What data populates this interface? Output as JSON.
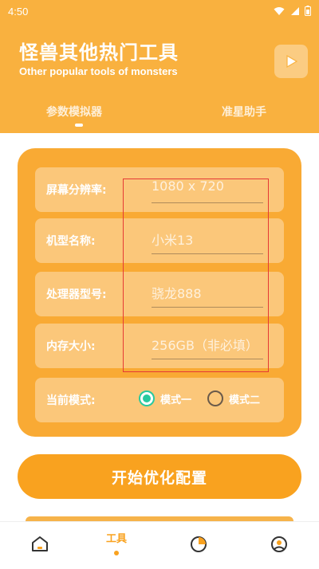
{
  "status_bar": {
    "time": "4:50",
    "icons": [
      "wifi-icon",
      "signal-icon",
      "battery-icon"
    ]
  },
  "header": {
    "title": "怪兽其他热门工具",
    "subtitle": "Other popular tools of monsters",
    "tabs": [
      {
        "label": "参数模拟器",
        "active": true
      },
      {
        "label": "准星助手",
        "active": false
      }
    ],
    "colors": {
      "primary": "#f9b13f",
      "accent": "#f9a21f",
      "radio": "#27c9a0"
    }
  },
  "form": {
    "resolution": {
      "label": "屏幕分辨率:",
      "placeholder": "1080 x 720"
    },
    "model": {
      "label": "机型名称:",
      "placeholder": "小米13"
    },
    "processor": {
      "label": "处理器型号:",
      "placeholder": "骁龙888"
    },
    "memory": {
      "label": "内存大小:",
      "placeholder": "256GB（非必填）"
    },
    "mode": {
      "label": "当前模式:",
      "options": [
        "模式一",
        "模式二"
      ],
      "selected": "模式一"
    }
  },
  "start_button": {
    "label": "开始优化配置"
  },
  "bottom_nav": {
    "items": [
      {
        "label": "",
        "icon": "home-icon"
      },
      {
        "label": "工具",
        "icon": "",
        "active": true
      },
      {
        "label": "",
        "icon": "chart-icon"
      },
      {
        "label": "",
        "icon": "profile-icon"
      }
    ]
  }
}
